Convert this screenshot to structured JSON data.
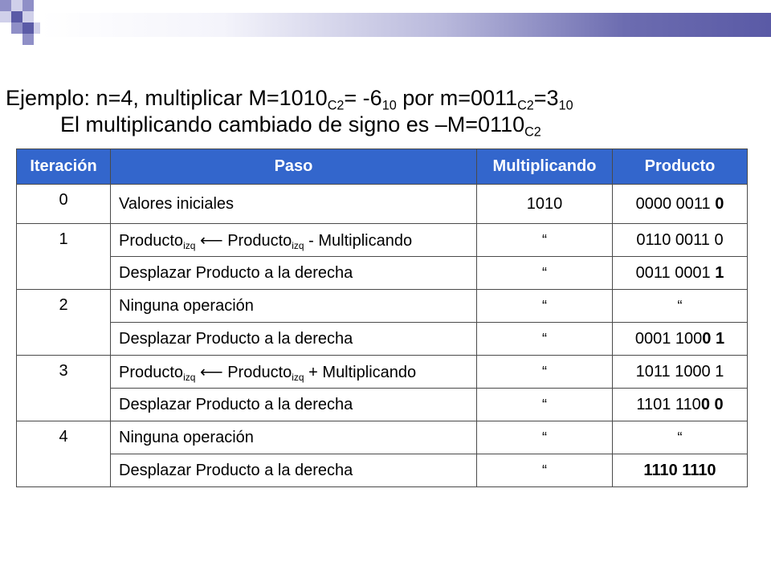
{
  "header": {
    "line1": {
      "a": "Ejemplo: n=4, multiplicar M=1010",
      "sub1": "C2",
      "b": "= -6",
      "sub2": "10",
      "c": " por m=0011",
      "sub3": "C2",
      "d": "=3",
      "sub4": "10"
    },
    "line2": {
      "a": "El multiplicando cambiado de signo es –M=0110",
      "sub1": "C2"
    }
  },
  "table": {
    "headers": [
      "Iteración",
      "Paso",
      "Multiplicando",
      "Producto"
    ],
    "rows": [
      {
        "iter": "0",
        "paso": "Valores iniciales",
        "mult": "1010",
        "prod": "0000 0011 ",
        "prod_bold": "0"
      },
      {
        "iter": "1",
        "paso_parts": {
          "a": "Producto",
          "s1": "izq",
          "arrow": " ⟵ ",
          "b": "Producto",
          "s2": "izq",
          "c": " - Multiplicando"
        },
        "mult": "“",
        "prod": "0110 0011 0",
        "prod_bold": ""
      },
      {
        "paso": "Desplazar Producto a la derecha",
        "mult": "“",
        "prod": "0011 0001 ",
        "prod_bold": "1"
      },
      {
        "iter": "2",
        "paso": "Ninguna operación",
        "mult": "“",
        "prod": "“",
        "prod_bold": ""
      },
      {
        "paso": "Desplazar Producto a la derecha",
        "mult": "“",
        "prod": "0001 100",
        "prod_bold": "0 1"
      },
      {
        "iter": "3",
        "paso_parts": {
          "a": "Producto",
          "s1": "izq",
          "arrow": " ⟵ ",
          "b": "Producto",
          "s2": "izq",
          "c": " + Multiplicando"
        },
        "mult": "“",
        "prod": "1011 1000 1",
        "prod_bold": ""
      },
      {
        "paso": "Desplazar Producto a la derecha",
        "mult": "“",
        "prod": "1101 110",
        "prod_bold": "0 0"
      },
      {
        "iter": "4",
        "paso": "Ninguna operación",
        "mult": "“",
        "prod": "“",
        "prod_bold": ""
      },
      {
        "paso": "Desplazar Producto a la derecha",
        "mult": "“",
        "prod": "",
        "prod_bold": "1110 1110"
      }
    ]
  },
  "colors": {
    "header_bg": "#3366cc",
    "deco_dark": "#5a5aa6",
    "deco_mid": "#8f8fc7",
    "deco_light": "#d0d0ea"
  }
}
